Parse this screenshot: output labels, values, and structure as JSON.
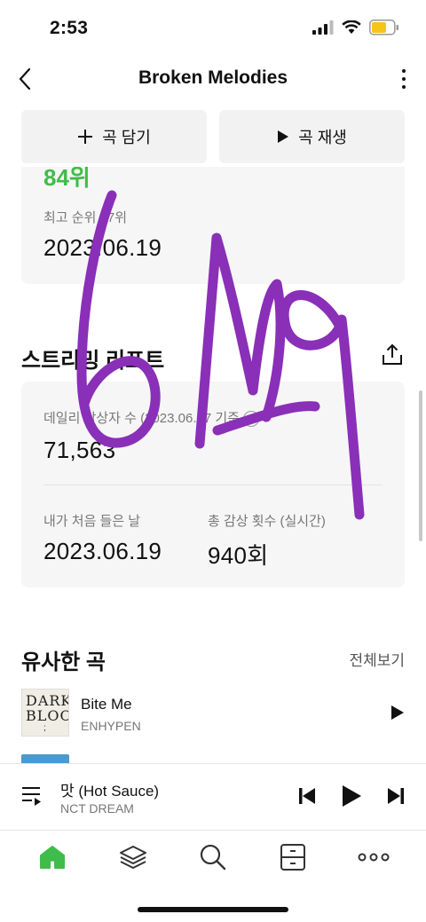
{
  "status": {
    "time": "2:53"
  },
  "nav": {
    "title": "Broken Melodies"
  },
  "actions": {
    "add_label": "곡 담기",
    "play_label": "곡 재생"
  },
  "rank": {
    "current": "84위",
    "best_label": "최고 순위 47위",
    "best_date": "2023.06.19"
  },
  "streaming": {
    "title": "스트리밍 리포트",
    "daily_label": "데일리 감상자 수 (2023.06.27 기준",
    "daily_value": "71,563",
    "first_listen_label": "내가 처음 들은 날",
    "first_listen_value": "2023.06.19",
    "total_plays_label": "총 감상 횟수 (실시간)",
    "total_plays_value": "940회"
  },
  "similar": {
    "title": "유사한 곡",
    "see_all": "전체보기",
    "songs": [
      {
        "title": "Bite Me",
        "artist": "ENHYPEN",
        "art_line1": "DARK",
        "art_line2": "BLOOD"
      }
    ]
  },
  "mini_player": {
    "title": "맛 (Hot Sauce)",
    "artist": "NCT DREAM"
  },
  "colors": {
    "accent_green": "#3fbd4a",
    "scribble_purple": "#8a2fb8"
  },
  "tabs": [
    {
      "name": "home-icon",
      "active": true
    },
    {
      "name": "layers-icon"
    },
    {
      "name": "search-icon"
    },
    {
      "name": "library-icon"
    },
    {
      "name": "more-icon"
    }
  ]
}
